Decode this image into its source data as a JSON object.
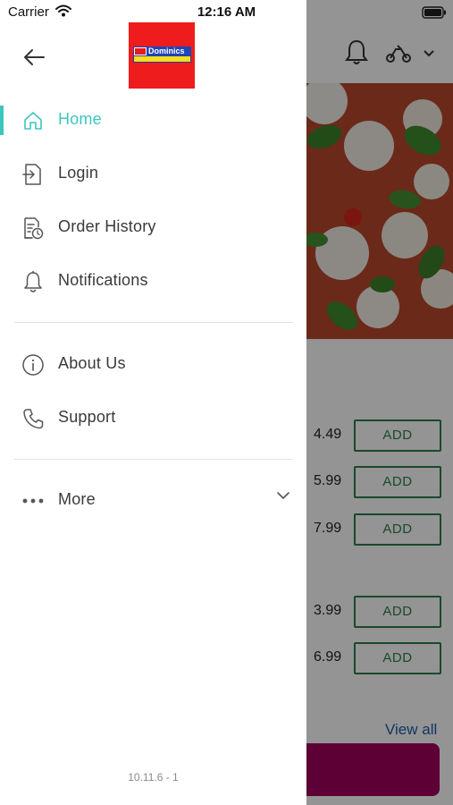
{
  "status_bar": {
    "carrier": "Carrier",
    "time": "12:16 AM"
  },
  "drawer": {
    "brand": {
      "logo_text": "Dominics"
    },
    "menu": [
      {
        "label": "Home",
        "icon": "home-icon",
        "active": true
      },
      {
        "label": "Login",
        "icon": "login-icon",
        "active": false
      },
      {
        "label": "Order History",
        "icon": "order-history-icon",
        "active": false
      },
      {
        "label": "Notifications",
        "icon": "bell-icon",
        "active": false
      },
      {
        "label": "About Us",
        "icon": "info-icon",
        "active": false
      },
      {
        "label": "Support",
        "icon": "phone-icon",
        "active": false
      },
      {
        "label": "More",
        "icon": "more-dots-icon",
        "active": false
      }
    ],
    "version": "10.11.6 - 1"
  },
  "background": {
    "prices": [
      "4.49",
      "5.99",
      "7.99",
      "3.99",
      "6.99"
    ],
    "add_label": "ADD",
    "view_all": "View all"
  },
  "colors": {
    "accent": "#3cc6c0",
    "add_green": "#2e7d4f",
    "cta": "#a0005e",
    "logo_red": "#ee1c1c"
  }
}
